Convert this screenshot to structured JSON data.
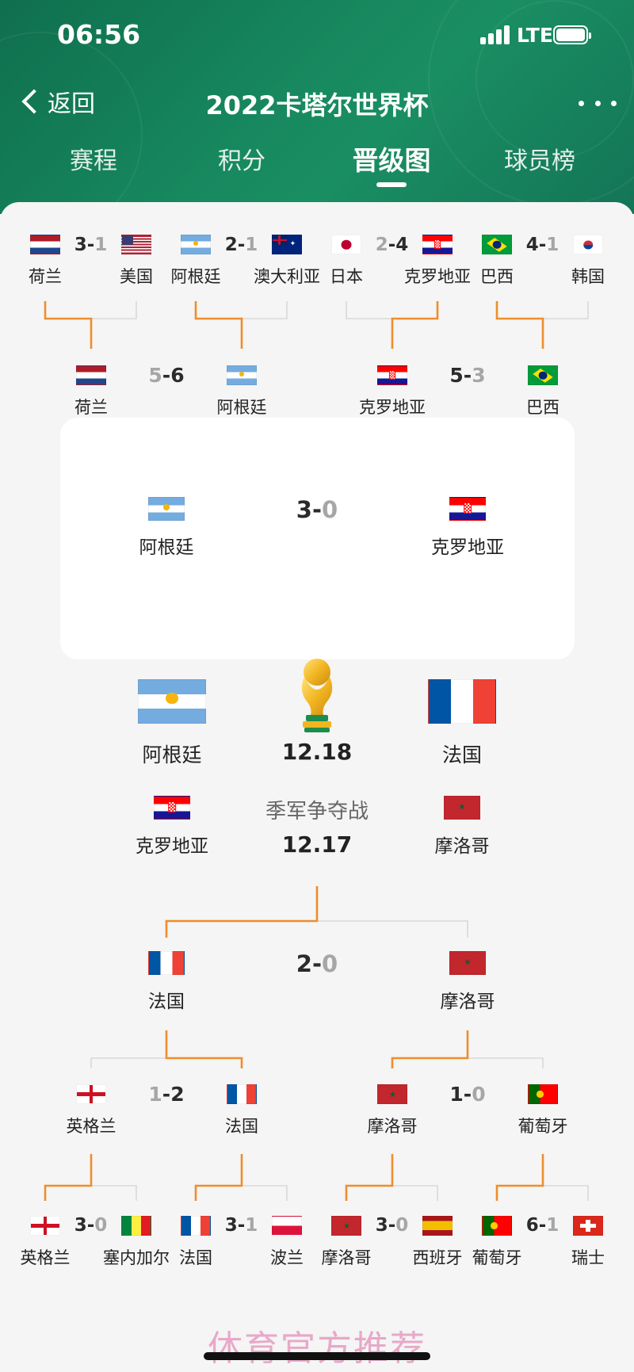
{
  "status": {
    "time": "06:56",
    "network": "LTE"
  },
  "header": {
    "back_label": "返回",
    "title": "2022卡塔尔世界杯"
  },
  "tabs": [
    {
      "label": "赛程",
      "active": false
    },
    {
      "label": "积分",
      "active": false
    },
    {
      "label": "晋级图",
      "active": true
    },
    {
      "label": "球员榜",
      "active": false
    }
  ],
  "colors": {
    "header_green": "#17885f",
    "bracket_orange": "#ef8d2c",
    "bracket_gray": "#d9d9d9"
  },
  "teams": {
    "ned": "荷兰",
    "usa": "美国",
    "arg": "阿根廷",
    "aus": "澳大利亚",
    "jpn": "日本",
    "cro": "克罗地亚",
    "bra": "巴西",
    "kor": "韩国",
    "eng": "英格兰",
    "sen": "塞内加尔",
    "fra": "法国",
    "pol": "波兰",
    "mar": "摩洛哥",
    "esp": "西班牙",
    "por": "葡萄牙",
    "sui": "瑞士"
  },
  "bracket": {
    "top_r16": [
      {
        "left": "ned",
        "right": "usa",
        "score_left": "3",
        "score_right": "1"
      },
      {
        "left": "arg",
        "right": "aus",
        "score_left": "2",
        "score_right": "1"
      },
      {
        "left": "jpn",
        "right": "cro",
        "score_left": "2",
        "score_right": "4"
      },
      {
        "left": "bra",
        "right": "kor",
        "score_left": "4",
        "score_right": "1"
      }
    ],
    "top_qf": [
      {
        "left": "ned",
        "right": "arg",
        "score_left": "5",
        "score_right": "6"
      },
      {
        "left": "cro",
        "right": "bra",
        "score_left": "5",
        "score_right": "3"
      }
    ],
    "top_sf": {
      "left": "arg",
      "right": "cro",
      "score_left": "3",
      "score_right": "0"
    },
    "final": {
      "left": "arg",
      "right": "fra",
      "date": "12.18"
    },
    "third_place": {
      "label": "季军争夺战",
      "left": "cro",
      "right": "mar",
      "date": "12.17"
    },
    "bottom_sf": {
      "left": "fra",
      "right": "mar",
      "score_left": "2",
      "score_right": "0"
    },
    "bottom_qf": [
      {
        "left": "eng",
        "right": "fra",
        "score_left": "1",
        "score_right": "2"
      },
      {
        "left": "mar",
        "right": "por",
        "score_left": "1",
        "score_right": "0"
      }
    ],
    "bottom_r16": [
      {
        "left": "eng",
        "right": "sen",
        "score_left": "3",
        "score_right": "0"
      },
      {
        "left": "fra",
        "right": "pol",
        "score_left": "3",
        "score_right": "1"
      },
      {
        "left": "mar",
        "right": "esp",
        "score_left": "3",
        "score_right": "0"
      },
      {
        "left": "por",
        "right": "sui",
        "score_left": "6",
        "score_right": "1"
      }
    ]
  },
  "watermark": "体育官方推荐"
}
